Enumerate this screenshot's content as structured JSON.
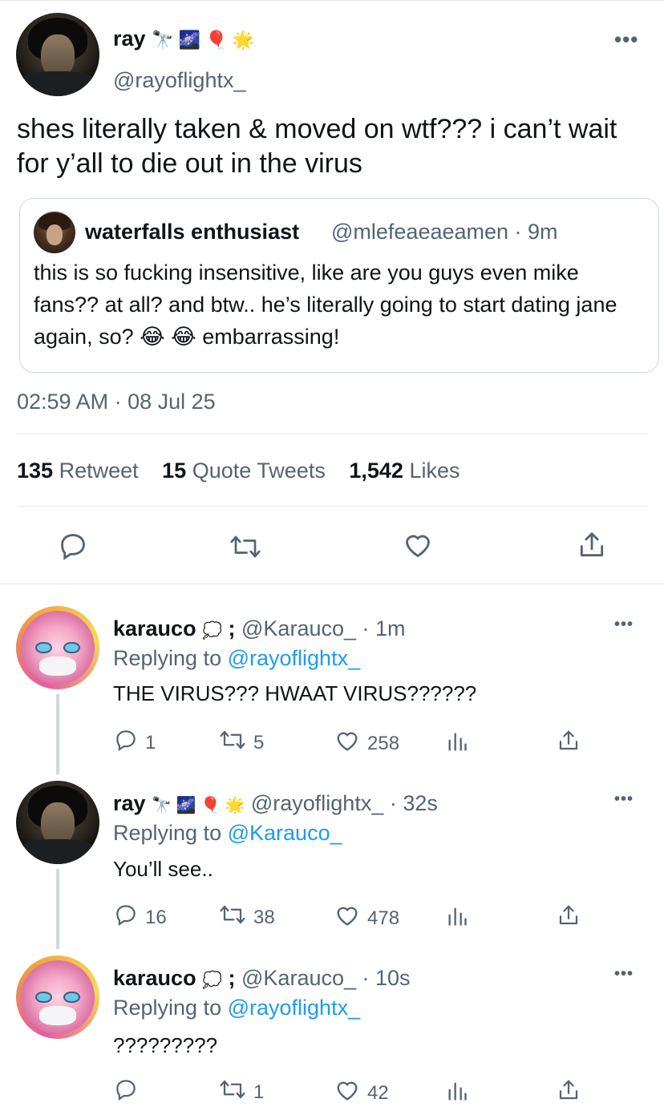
{
  "main_tweet": {
    "name": "ray",
    "name_emojis": "🔭 🌌 🎈 🌟",
    "handle": "@rayoflightx_",
    "more": "•••",
    "text": "shes literally taken & moved on wtf??? i can’t wait for y’all to die out in the virus",
    "quote": {
      "name": "waterfalls enthusiast",
      "handle_time": "@mlefeaeaeamen · 9m",
      "text_1": "this is so fucking insensitive, like are you guys even mike fans?? at all? and btw.. he’s literally going to start dating jane again, so?",
      "emojis": "😂 😂",
      "text_2": "embarrassing!"
    },
    "timestamp": "02:59 AM · 08 Jul 25",
    "stats": {
      "retweets_count": "135",
      "retweets_label": "Retweet",
      "quotes_count": "15",
      "quotes_label": "Quote Tweets",
      "likes_count": "1,542",
      "likes_label": "Likes"
    }
  },
  "replies": [
    {
      "name": "karauco",
      "emoji": "💭",
      "semicolon": ";",
      "handle_time": "@Karauco_ · 1m",
      "replying_label": "Replying to",
      "replying_to": "@rayoflightx_",
      "text": "THE VIRUS??? HWAAT VIRUS??????",
      "replies": "1",
      "retweets": "5",
      "likes": "258"
    },
    {
      "name": "ray",
      "emoji": "🔭 🌌 🎈 🌟",
      "handle_time": "@rayoflightx_ · 32s",
      "replying_label": "Replying to",
      "replying_to": "@Karauco_",
      "text": "You’ll see..",
      "replies": "16",
      "retweets": "38",
      "likes": "478"
    },
    {
      "name": "karauco",
      "emoji": "💭",
      "semicolon": ";",
      "handle_time": "@Karauco_ · 10s",
      "replying_label": "Replying to",
      "replying_to": "@rayoflightx_",
      "text": "?????????",
      "replies": "",
      "retweets": "1",
      "likes": "42"
    }
  ],
  "colors": {
    "text": "#0f1419",
    "secondary": "#536471",
    "link": "#1d9bf0",
    "divider": "#e1e8ed"
  }
}
